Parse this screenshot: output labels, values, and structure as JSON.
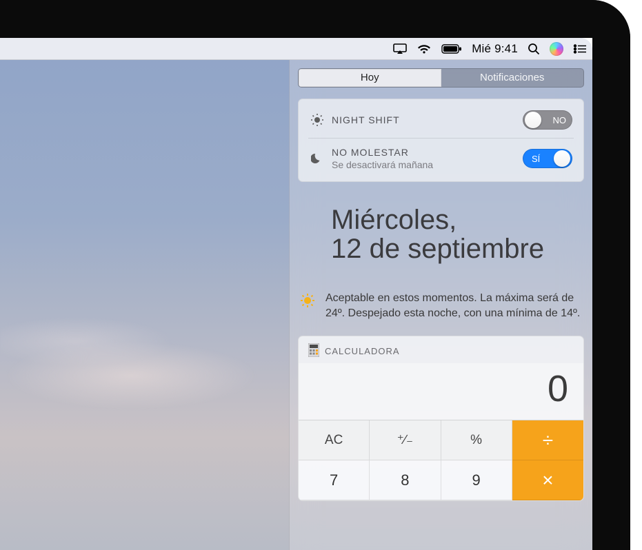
{
  "menubar": {
    "clock": "Mié 9:41"
  },
  "nc": {
    "tabs": {
      "today": "Hoy",
      "notifications": "Notificaciones"
    },
    "nightshift": {
      "title": "NIGHT SHIFT",
      "state_label": "NO"
    },
    "dnd": {
      "title": "NO MOLESTAR",
      "subtitle": "Se desactivará mañana",
      "state_label": "SÍ"
    },
    "date": {
      "line1": "Miércoles,",
      "line2": "12 de septiembre"
    },
    "weather": {
      "text": "Aceptable en estos momentos. La máxima será de 24º. Despejado esta noche, con una mínima de 14º."
    },
    "calculator": {
      "title": "CALCULADORA",
      "display": "0",
      "row_fn": [
        "AC",
        "⁺∕₋",
        "%",
        "÷"
      ],
      "row_1": [
        "7",
        "8",
        "9",
        "×"
      ]
    }
  }
}
